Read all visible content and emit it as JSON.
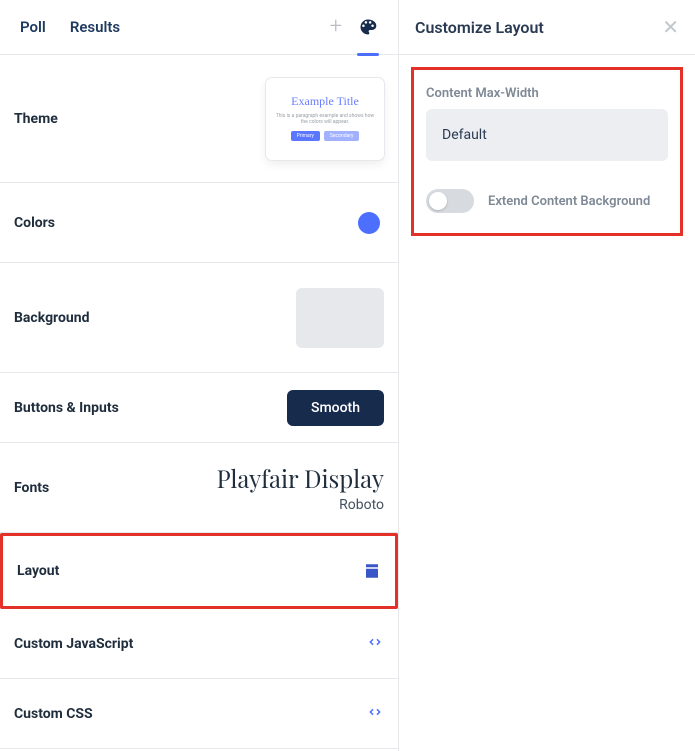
{
  "tabs": {
    "poll": "Poll",
    "results": "Results"
  },
  "left": {
    "theme": {
      "label": "Theme",
      "preview": {
        "title": "Example Title",
        "para": "This is a paragraph example and shows how the colors will appear.",
        "primary": "Primary",
        "secondary": "Secondary"
      }
    },
    "colors": {
      "label": "Colors",
      "accent": "#4c6fff"
    },
    "background": {
      "label": "Background"
    },
    "buttons": {
      "label": "Buttons & Inputs",
      "value": "Smooth"
    },
    "fonts": {
      "label": "Fonts",
      "serif": "Playfair Display",
      "sans": "Roboto"
    },
    "layout": {
      "label": "Layout"
    },
    "customjs": {
      "label": "Custom JavaScript"
    },
    "customcss": {
      "label": "Custom CSS"
    }
  },
  "right": {
    "title": "Customize Layout",
    "maxwidth": {
      "label": "Content Max-Width",
      "value": "Default"
    },
    "extend": {
      "label": "Extend Content Background",
      "on": false
    }
  }
}
